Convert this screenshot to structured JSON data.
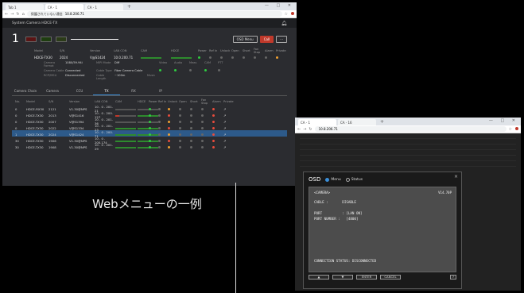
{
  "browser_main": {
    "tabs": [
      "Tab 1",
      "CA - 1",
      "CA - 1"
    ],
    "nav_icons": [
      "back-icon",
      "forward-icon",
      "reload-icon",
      "home-icon"
    ],
    "url_prefix": "保護されていない通信",
    "url": "10.8.206.71",
    "window_controls": "— □ ✕"
  },
  "app": {
    "title": "System Camera HDCE-TX",
    "camera_number": "1",
    "buttons": {
      "osd_menu": "OSD Menu",
      "call": "Call",
      "more": "···"
    },
    "main_header": [
      "Model",
      "S/N",
      "Version",
      "LAN CON",
      "CAM",
      "HDCE",
      "Power",
      "Ref In",
      "Unlock",
      "Open",
      "Short",
      "Fan Stop",
      "Alarm",
      "Private"
    ],
    "main_values": [
      "HDCE-TX30",
      "2024",
      "V@S1424",
      "10.0.200.71"
    ],
    "info": [
      {
        "label": "Camera Format",
        "value": "1080/59.94i"
      },
      {
        "label": "Camera Cable",
        "value": "Connected"
      },
      {
        "label": "RCP/MSU",
        "value": "Disconnected"
      }
    ],
    "info2": [
      {
        "label": "MIPI Mode",
        "value": "Diff"
      },
      {
        "label": "Cable Type",
        "value": "Fiber Camera Cable"
      },
      {
        "label": "Cable Length",
        "value": "~100m"
      }
    ],
    "info3": [
      "Video",
      "Audio",
      "Meas",
      "CAM",
      "PTT",
      "Music"
    ],
    "chain_tabs": [
      "Camera Chain",
      "Camera",
      "CCU",
      "TX",
      "RX",
      "IP"
    ],
    "active_chain_tab": "TX",
    "table_header": [
      "No.",
      "Model",
      "S/N",
      "Version",
      "LAN CON",
      "CAM",
      "HDCE",
      "Power",
      "Ref In",
      "Unlock",
      "Open",
      "Short",
      "Fan Stop",
      "Alarm",
      "Private"
    ],
    "rows": [
      {
        "no": "0",
        "model": "HDCE-RX30",
        "sn": "2121",
        "version": "V1.30@NPS",
        "lan": "10 . 0 . 201. 21"
      },
      {
        "no": "0",
        "model": "HDCE-TX30",
        "sn": "2013",
        "version": "V@S1416",
        "lan": "10 . 0 . 200. 127"
      },
      {
        "no": "0",
        "model": "HDCE-TX30",
        "sn": "2007",
        "version": "V@S1394",
        "lan": "10 . 0 . 201. 36"
      },
      {
        "no": "0",
        "model": "HDCE-TX30",
        "sn": "2022",
        "version": "V@S1334",
        "lan": "10 . 0 . 201. 23"
      },
      {
        "no": "1",
        "model": "HDCE-TX30",
        "sn": "2024",
        "version": "V@S1424",
        "lan": "10 . 0 . 200. 71"
      },
      {
        "no": "30",
        "model": "HDCE-TX30",
        "sn": "1906",
        "version": "V1.30@NPS",
        "lan": "10 . 0 . 200.174"
      },
      {
        "no": "30",
        "model": "HDCE-TX30",
        "sn": "1908",
        "version": "V1.30@NPS",
        "lan": "10 . 0 . 201. 29"
      }
    ],
    "selected_row": 4
  },
  "caption": "Webメニューの一例",
  "browser_osd": {
    "tabs": [
      "CA - 1",
      "CA - 16"
    ],
    "url": "10.8.206.71",
    "window_controls": "— □ ✕"
  },
  "osd": {
    "title": "OSD",
    "mode_menu": "Menu",
    "mode_status": "Status",
    "close": "×",
    "screen": {
      "line1": "<CAMERA>",
      "version": "V14.70P",
      "line2": "CABLE :       DISABLE",
      "line3": "PORT          : [LAN ON]",
      "line4": "PORT NUMBER :   [4800]",
      "status": "CONNECTION STATUS: DISCONNECTED"
    },
    "buttons": {
      "up": "▲",
      "down": "▼",
      "enter": "ENTER",
      "cancel": "CANCEL",
      "help": "?"
    }
  },
  "colors": {
    "accent": "#3b8ed8",
    "alert": "#c0392b",
    "ok": "#2ecc40",
    "warn": "#f0a030"
  }
}
